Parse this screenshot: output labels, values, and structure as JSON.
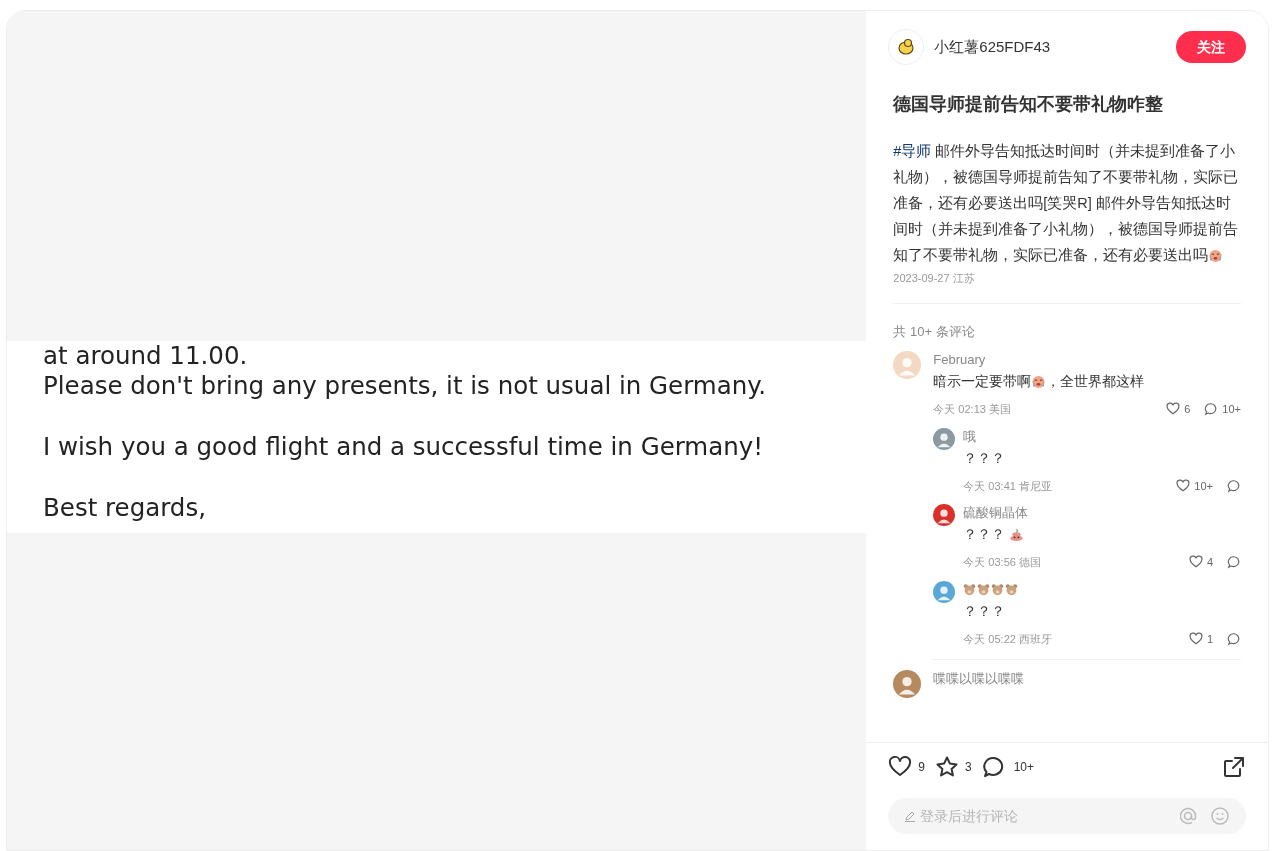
{
  "image": {
    "email_paragraphs": [
      [
        "at around 11.00.",
        "Please don't bring any presents, it is not usual in Germany."
      ],
      [
        "I wish you a good flight and a successful time in Germany!"
      ],
      [
        "Best regards,"
      ]
    ]
  },
  "author": {
    "name": "小红薯625FDF43",
    "follow_label": "关注"
  },
  "post": {
    "title": "德国导师提前告知不要带礼物咋整",
    "tag": "#导师",
    "body": "邮件外导告知抵达时间时（并未提到准备了小礼物），被德国导师提前告知了不要带礼物，实际已准备，还有必要送出吗[笑哭R] 邮件外导告知抵达时间时（并未提到准备了小礼物），被德国导师提前告知了不要带礼物，实际已准备，还有必要送出吗",
    "body_end": {
      "kind": "crying_emoji"
    },
    "date": "2023-09-27 江苏"
  },
  "comments_count": "共 10+ 条评论",
  "comments": [
    {
      "author": "February",
      "parts": [
        {
          "kind": "text",
          "text": "暗示一定要带啊"
        },
        {
          "kind": "crying_emoji"
        },
        {
          "kind": "text",
          "text": "，全世界都这样"
        }
      ],
      "time": "今天 02:13",
      "location": "美国",
      "likes": "6",
      "replies_count": "10+",
      "replies": [
        {
          "author": "哦",
          "parts": [
            {
              "kind": "text",
              "text": "？？？"
            }
          ],
          "time": "今天 03:41",
          "location": "肯尼亚",
          "likes": "10+"
        },
        {
          "author": "硫酸铜晶体",
          "parts": [
            {
              "kind": "text",
              "text": "？？？"
            },
            {
              "kind": "poop_emoji"
            }
          ],
          "time": "今天 03:56",
          "location": "德国",
          "likes": "4"
        },
        {
          "kind": "bear_emoji_name",
          "parts": [
            {
              "kind": "text",
              "text": "？？？"
            }
          ],
          "time": "今天 05:22",
          "location": "西班牙",
          "likes": "1"
        }
      ]
    },
    {
      "author": "喋喋以喋以喋喋"
    }
  ],
  "actions": {
    "likes": "9",
    "collects": "3",
    "comments": "10+"
  },
  "comment_input": {
    "placeholder": "登录后进行评论"
  }
}
